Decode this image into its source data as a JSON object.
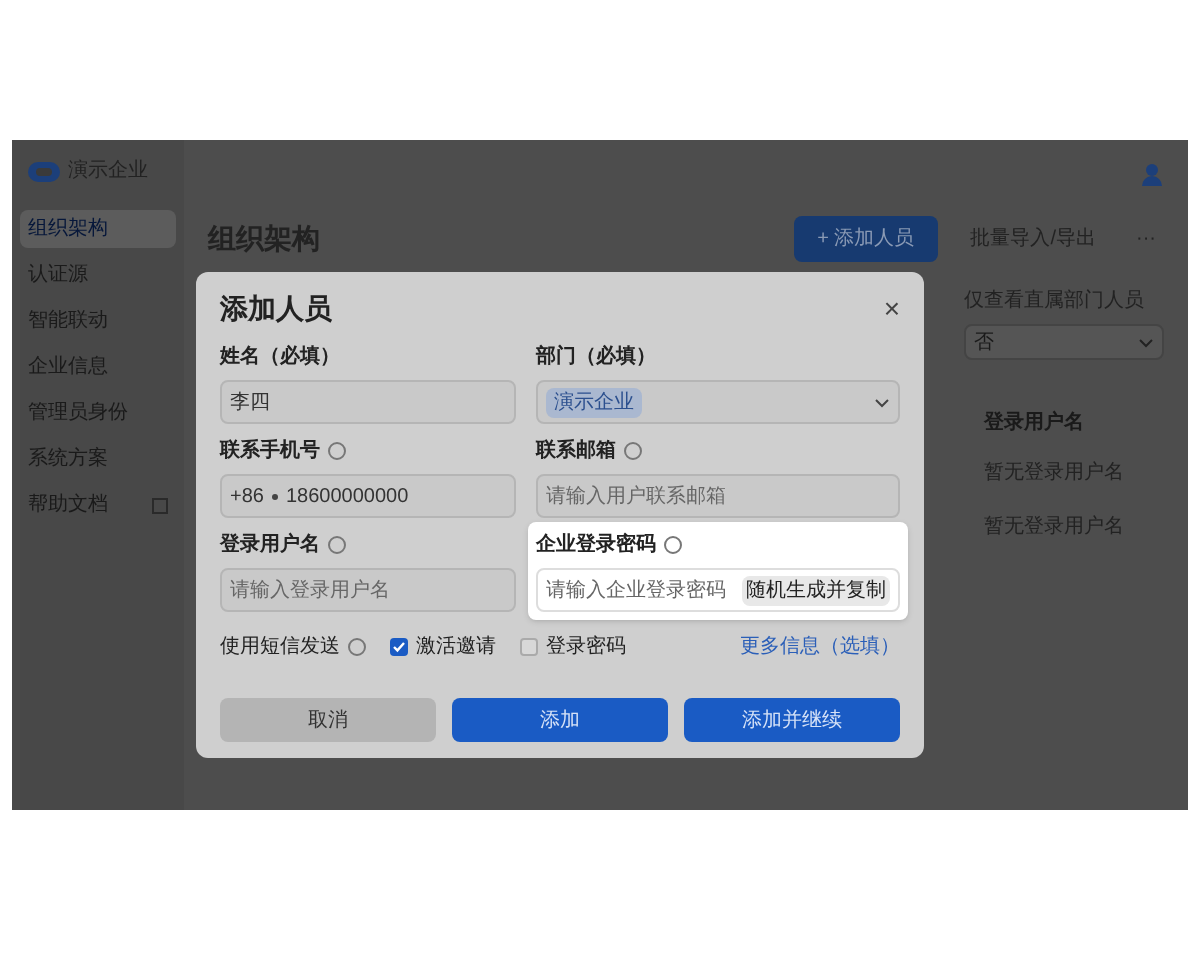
{
  "sidebar": {
    "brand": "演示企业",
    "items": [
      {
        "label": "组织架构",
        "selected": true,
        "external": false
      },
      {
        "label": "认证源",
        "selected": false,
        "external": false
      },
      {
        "label": "智能联动",
        "selected": false,
        "external": false
      },
      {
        "label": "企业信息",
        "selected": false,
        "external": false
      },
      {
        "label": "管理员身份",
        "selected": false,
        "external": false
      },
      {
        "label": "系统方案",
        "selected": false,
        "external": false
      },
      {
        "label": "帮助文档",
        "selected": false,
        "external": true
      }
    ]
  },
  "main": {
    "title": "组织架构",
    "actions": [
      {
        "label": "+ 添加人员",
        "kind": "primary"
      },
      {
        "label": "批量导入/导出",
        "kind": "plain"
      },
      {
        "label": "···",
        "kind": "more"
      }
    ],
    "filter": {
      "label": "仅查看直属部门人员",
      "value": "否"
    },
    "table": {
      "columns": [
        "登录用户名"
      ],
      "rows": [
        [
          "暂无登录用户名"
        ],
        [
          "暂无登录用户名"
        ]
      ]
    }
  },
  "dialog": {
    "title": "添加人员",
    "close": "×",
    "fields": [
      {
        "kind": "text",
        "label": "姓名（必填）",
        "info": false,
        "value": "李四"
      },
      {
        "kind": "select",
        "label": "部门（必填）",
        "info": false,
        "value": "演示企业"
      },
      {
        "kind": "phone",
        "label": "联系手机号",
        "info": true,
        "prefix": "+86",
        "value": "18600000000"
      },
      {
        "kind": "text",
        "label": "联系邮箱",
        "info": true,
        "placeholder": "请输入用户联系邮箱"
      },
      {
        "kind": "text",
        "label": "登录用户名",
        "info": true,
        "placeholder": "请输入登录用户名"
      },
      {
        "kind": "password",
        "label": "企业登录密码",
        "info": true,
        "placeholder": "请输入企业登录密码",
        "button": "随机生成并复制",
        "highlighted": true
      }
    ],
    "send": {
      "label": "使用短信发送",
      "info": true,
      "options": [
        {
          "label": "激活邀请",
          "checked": true
        },
        {
          "label": "登录密码",
          "checked": false
        }
      ]
    },
    "more_link": "更多信息（选填）",
    "buttons": [
      {
        "label": "取消",
        "kind": "secondary"
      },
      {
        "label": "添加",
        "kind": "primary"
      },
      {
        "label": "添加并继续",
        "kind": "primary"
      }
    ]
  }
}
